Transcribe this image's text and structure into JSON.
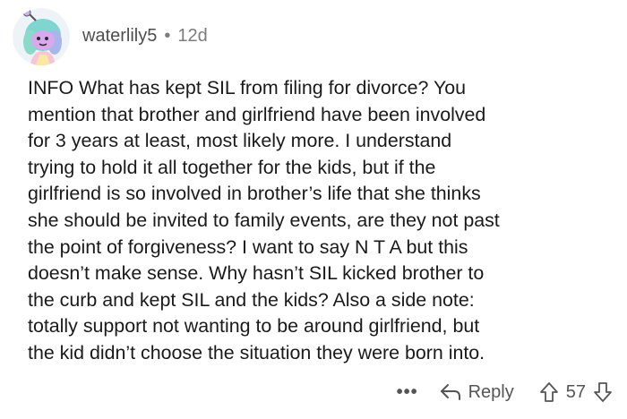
{
  "comment": {
    "username": "waterlily5",
    "separator": "•",
    "timestamp": "12d",
    "avatar_icon": "snoo-avatar-icon",
    "body_lines": [
      "INFO What has kept SIL from filing for divorce? You",
      "mention that brother and girlfriend have been involved",
      "for 3 years at least, most likely more. I understand",
      "trying to hold it all together for the kids, but if the",
      "girlfriend is so involved in brother’s life that she thinks",
      "she should be invited to family events, are they not past",
      "the point of forgiveness? I want to say N T A but this",
      "doesn’t make sense. Why hasn’t SIL kicked brother to",
      "the curb and kept SIL and the kids? Also a side note:",
      "totally support not wanting to be around girlfriend, but",
      "the kid didn’t choose the situation they were born into."
    ],
    "actions": {
      "more_label": "•••",
      "reply_label": "Reply",
      "vote_count": "57",
      "upvote_icon": "upvote-arrow-icon",
      "downvote_icon": "downvote-arrow-icon",
      "reply_icon": "reply-arrow-icon"
    }
  }
}
